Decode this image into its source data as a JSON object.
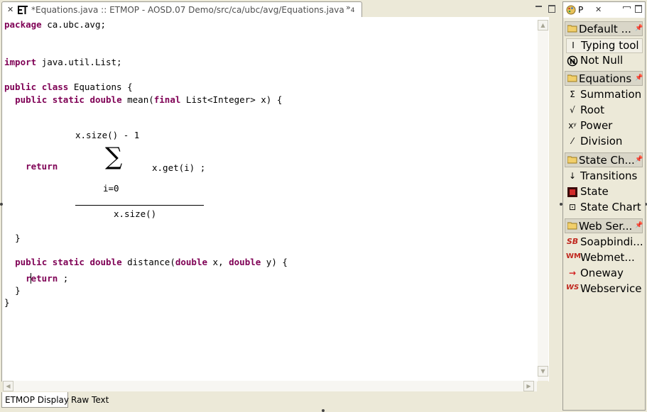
{
  "editor": {
    "tab_title": "*Equations.java :: ETMOP - AOSD.07 Demo/src/ca/ubc/avg/Equations.java",
    "overflow_count": "4",
    "code": {
      "package_kw": "package",
      "package_name": " ca.ubc.avg;",
      "import_kw": "import",
      "import_name": " java.util.List;",
      "public": "public",
      "class": "class",
      "class_name": " Equations {",
      "static": "static",
      "double": "double",
      "final": "final",
      "return": "return",
      "mean_sig": " mean(",
      "mean_params": " List<Integer> x) {",
      "distance_sig": " distance(",
      "x_param": " x, ",
      "y_param": " y) {",
      "return_rest": " ;",
      "close_brace": "}"
    },
    "equation": {
      "upper_bound": "x.size() - 1",
      "sigma": "∑",
      "term": "x.get(i) ;",
      "lower_bound": "i=0",
      "denominator": "x.size()"
    },
    "bottom_tabs": [
      "ETMOP Display",
      "Raw Text"
    ]
  },
  "palette": {
    "title": "P",
    "drawers": [
      {
        "label": "Default ..."
      },
      {
        "label": "Equations"
      },
      {
        "label": "State Ch..."
      },
      {
        "label": "Web Ser..."
      }
    ],
    "tools": [
      {
        "label": "Typing tool",
        "icon": "text-cursor-icon",
        "glyph": "I"
      },
      {
        "label": "Not Null",
        "icon": "not-null-icon",
        "glyph": "N"
      },
      {
        "label": "Summation",
        "icon": "sigma-icon",
        "glyph": "Σ"
      },
      {
        "label": "Root",
        "icon": "root-icon",
        "glyph": "√"
      },
      {
        "label": "Power",
        "icon": "power-icon",
        "glyph": "xʸ"
      },
      {
        "label": "Division",
        "icon": "division-icon",
        "glyph": "⁄"
      },
      {
        "label": "Transitions",
        "icon": "arrow-down-icon",
        "glyph": "↓"
      },
      {
        "label": "State",
        "icon": "state-icon",
        "glyph": "■"
      },
      {
        "label": "State Chart",
        "icon": "state-chart-icon",
        "glyph": "⊡"
      },
      {
        "label": "Soapbindi...",
        "icon": "soapbinding-icon",
        "glyph": "SB"
      },
      {
        "label": "Webmet...",
        "icon": "webmethod-icon",
        "glyph": "WM"
      },
      {
        "label": "Oneway",
        "icon": "arrow-right-icon",
        "glyph": "→"
      },
      {
        "label": "Webservice",
        "icon": "webservice-icon",
        "glyph": "WS"
      }
    ]
  },
  "colors": {
    "keyword": "#7f0055",
    "background": "#ece9d8"
  }
}
